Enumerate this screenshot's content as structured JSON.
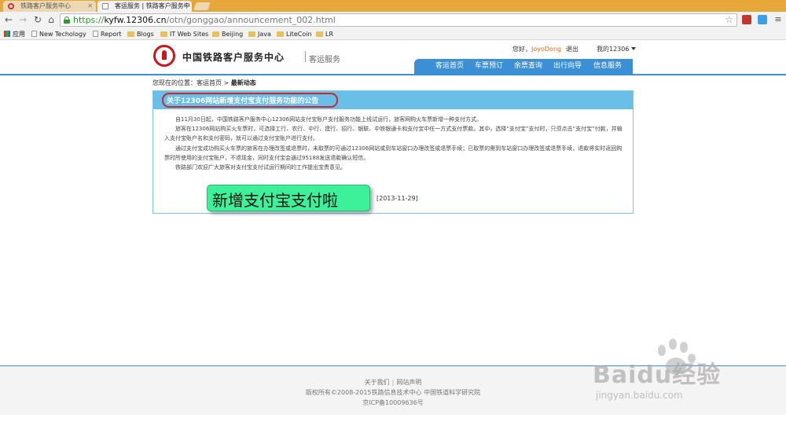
{
  "browser": {
    "tabs": [
      {
        "label": "铁路客户服务中心",
        "active": false
      },
      {
        "label": "客运服务 | 铁路客户服务中",
        "active": true
      }
    ],
    "url": {
      "protocol": "https://",
      "host": "kyfw.12306.cn",
      "path": "/otn/gonggao/announcement_002.html"
    },
    "bookmarks": [
      "应用",
      "New Techology",
      "Report",
      "Blogs",
      "IT Web Sites",
      "Beijing",
      "Java",
      "LiteCoin",
      "LR"
    ]
  },
  "header": {
    "logo_title": "中国铁路客户服务中心",
    "logo_subtitle": "客运服务",
    "greeting": "您好，",
    "username": "JoyoDong",
    "logout": "退出",
    "my12306": "我的12306"
  },
  "nav": [
    "客运首页",
    "车票预订",
    "余票查询",
    "出行向导",
    "信息服务"
  ],
  "breadcrumb": {
    "prefix": "您现在的位置：",
    "home": "客运首页",
    "sep": " > ",
    "current": "最新动态"
  },
  "notice": {
    "title": "关于12306网站新增支付宝支付服务功能的公告",
    "paragraphs": [
      "自11月30日起，中国铁路客户服务中心12306网站支付宝账户支付服务功能上线试运行，旅客网购火车票新增一种支付方式。",
      "旅客在12306网站购买火车票时，可选择工行、农行、中行、建行、招行、银联、中铁银通卡和支付宝中任一方式支付票款。其中，选择“支付宝”支付时，只须点击“支付宝”付款，并输入支付宝账户名和支付密码，就可以通过支付宝账户进行支付。",
      "通过支付宝成功购买火车票的旅客在办理改签或退票时，未取票的可通过12306网站或到车站窗口办理改签或退票手续；已取票的需到车站窗口办理改签或退票手续，退款将实时返回购票时所使用的支付宝账户，不退现金，同时支付宝会通过95188发送退款确认短信。",
      "铁路部门欢迎广大旅客对支付宝支付试运行期间的工作提出宝贵意见。"
    ],
    "date": "[2013-11-29]",
    "sticker": "新增支付宝支付啦"
  },
  "footer": {
    "links": [
      "关于我们",
      "网站声明"
    ],
    "copyright": "版权所有©2008-2015铁路信息技术中心  中国铁道科学研究院",
    "icp": "京ICP备10009636号"
  },
  "watermark": {
    "brand": "Baidu经验",
    "url": "jingyan.baidu.com"
  },
  "colors": {
    "accent_blue": "#3b8fd4",
    "panel_head": "#69bfe8",
    "logo_red": "#c8181e",
    "sticker_green": "#3df09a",
    "tab_orange": "#e8a73a"
  }
}
